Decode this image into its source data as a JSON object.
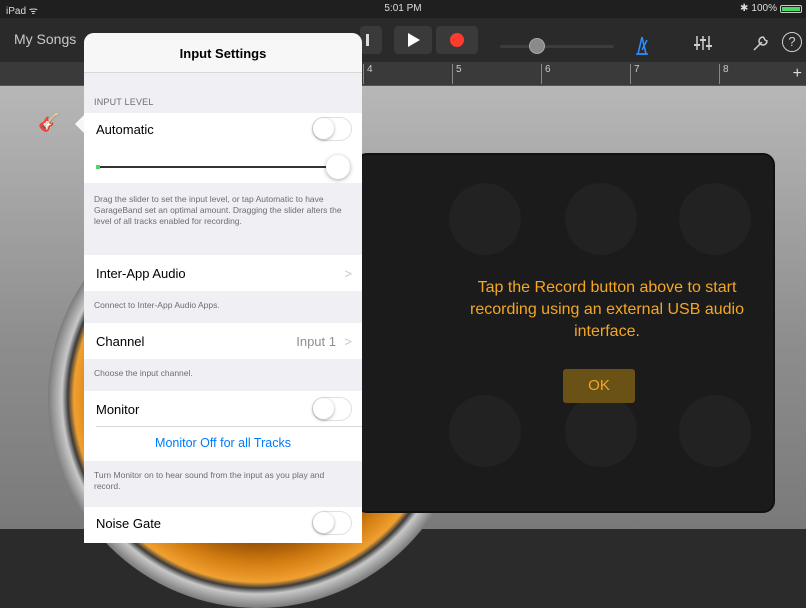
{
  "status_bar": {
    "device": "iPad",
    "wifi_icon": "wifi-icon",
    "time": "5:01 PM",
    "bluetooth_icon": "bluetooth-icon",
    "battery": "100%"
  },
  "toolbar": {
    "my_songs": "My Songs",
    "icons": [
      "rewind-icon",
      "play-icon",
      "record-icon",
      "metronome-icon",
      "mixer-icon",
      "wrench-icon",
      "help-icon"
    ],
    "master_volume": 0.3,
    "help_glyph": "?"
  },
  "ruler": {
    "marks": [
      "4",
      "5",
      "6",
      "7",
      "8"
    ],
    "plus": "+"
  },
  "input_settings": {
    "title": "Input Settings",
    "input_level_header": "INPUT LEVEL",
    "automatic_label": "Automatic",
    "automatic_on": false,
    "input_level": 1.0,
    "slider_help": "Drag the slider to set the input level, or tap Automatic to have GarageBand set an optimal amount. Dragging the slider alters the level of all tracks enabled for recording.",
    "inter_app_label": "Inter-App Audio",
    "inter_app_footer": "Connect to Inter-App Audio Apps.",
    "channel_label": "Channel",
    "channel_value": "Input 1",
    "channel_footer": "Choose the input channel.",
    "monitor_label": "Monitor",
    "monitor_on": false,
    "monitor_link": "Monitor Off for all Tracks",
    "monitor_footer": "Turn Monitor on to hear sound from the input as you play and record.",
    "noise_gate_label": "Noise Gate",
    "noise_gate_on": false,
    "chevron": ">"
  },
  "panel": {
    "message": "Tap the Record button above to start recording using an external USB audio interface.",
    "ok_label": "OK"
  },
  "amp_plus": "+",
  "colors": {
    "accent_orange": "#f5a623",
    "link_blue": "#007aff",
    "record_red": "#ff3b30",
    "battery_green": "#4cd964"
  }
}
